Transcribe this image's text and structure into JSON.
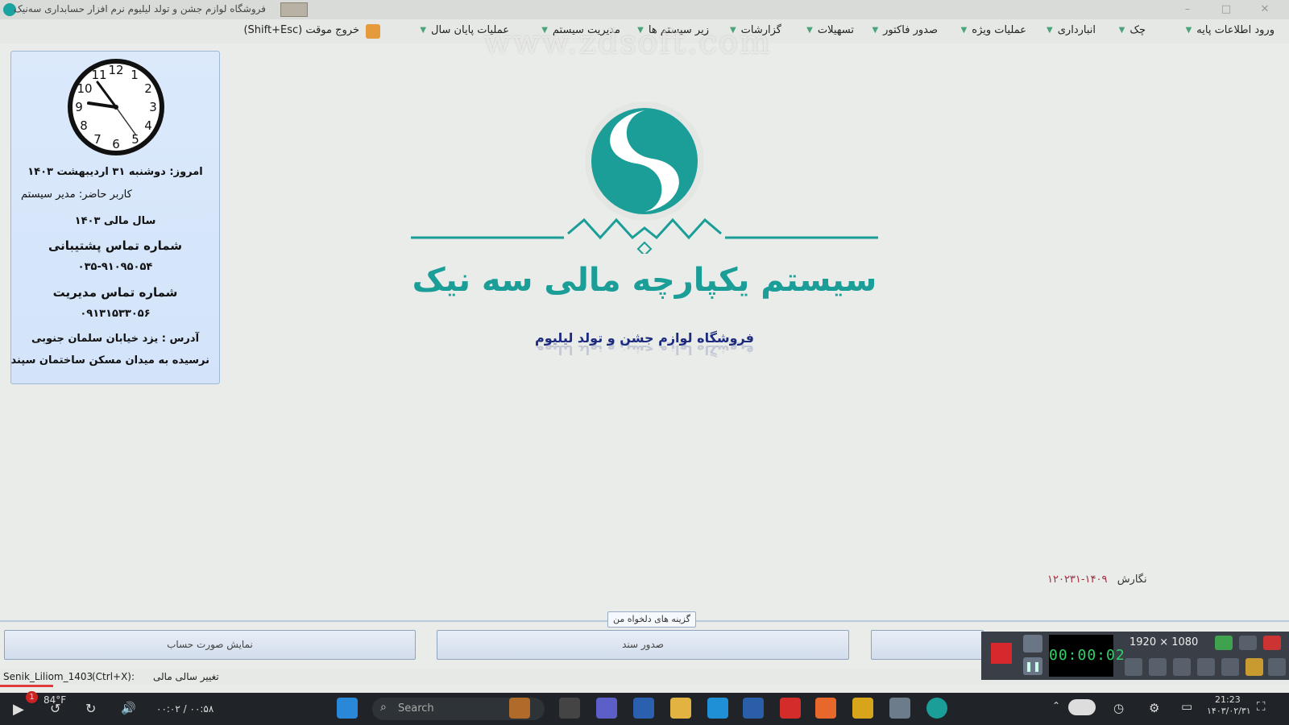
{
  "titlebar": {
    "title": "فروشگاه لوازم جشن و تولد لیلیوم نرم افزار حسابداری سه‌نیک"
  },
  "menu": {
    "items": [
      "ورود اطلاعات پایه",
      "چک",
      "انبارداری",
      "عملیات ویژه",
      "صدور فاکتور",
      "تسهیلات",
      "گزارشات",
      "زیر سیستم ها",
      "مدیریت سیستم",
      "عملیات پایان سال",
      "خروج موقت (Shift+Esc)"
    ]
  },
  "watermark": "www.zdsoft.com",
  "info_panel": {
    "today": "امروز: دوشنبه ۳۱ اردیبهشت ۱۴۰۳",
    "current_user": "کاربر حاضر: مدیر سیستم",
    "fiscal_year": "سال مالی ۱۴۰۳",
    "support_label": "شماره تماس پشتیبانی",
    "support_number": "۰۳۵-۹۱۰۹۵۰۵۴",
    "management_label": "شماره تماس مدیریت",
    "management_number": "۰۹۱۳۱۵۳۳۰۵۶",
    "address_line1": "آدرس : یزد خیابان سلمان جنوبی",
    "address_line2": "نرسیده به میدان مسکن ساختمان سپند"
  },
  "brand": {
    "title": "سیستم یکپارچه مالی سه نیک",
    "company": "فروشگاه لوازم جشن و تولد لیلیوم"
  },
  "version": {
    "label": "نگارش",
    "number": "۱۴۰۹-۱۲۰۲۳۱"
  },
  "favorites": {
    "label": "گزینه های دلخواه من",
    "buttons": [
      "صدور سند",
      "نمایش صورت حساب"
    ]
  },
  "statusbar": {
    "db_name": "Senik_Liliom_1403",
    "shortcut": "(Ctrl+X):",
    "change_year": "تغییر سالی مالی"
  },
  "recorder": {
    "timer": "00:00:02",
    "resolution": "1920 × 1080"
  },
  "taskbar": {
    "weather_temp": "84°F",
    "notification_count": "1",
    "media_time": "۰۰:۰۲ / ۰۰:۵۸",
    "search_placeholder": "Search",
    "clock_time": "21:23",
    "clock_date": "۱۴۰۳/۰۲/۳۱"
  },
  "colors": {
    "brand_teal": "#1b9d98",
    "company_navy": "#1c2a80",
    "panel_blue": "#d6e6fa"
  }
}
